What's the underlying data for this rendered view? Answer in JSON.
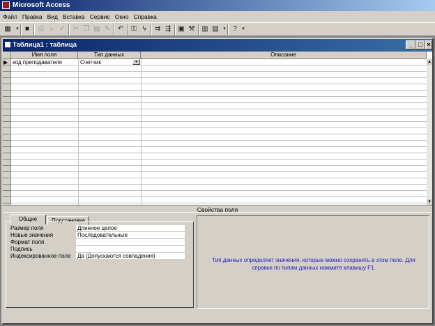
{
  "app": {
    "title": "Microsoft Access"
  },
  "menu": [
    "Файл",
    "Правка",
    "Вид",
    "Вставка",
    "Сервис",
    "Окно",
    "Справка"
  ],
  "window": {
    "title": "Таблица1 : таблица"
  },
  "grid": {
    "columns": [
      "Имя поля",
      "Тип данных",
      "Описание"
    ],
    "rows": [
      {
        "field_name": "код преподавателя",
        "data_type": "Счетчик",
        "description": ""
      }
    ]
  },
  "properties": {
    "section_title": "Свойства поля",
    "tabs": [
      "Общие",
      "Подстановка"
    ],
    "active_tab": "Общие",
    "items": [
      {
        "label": "Размер поля",
        "value": "Длинное целое"
      },
      {
        "label": "Новые значения",
        "value": "Последовательные"
      },
      {
        "label": "Формат поля",
        "value": ""
      },
      {
        "label": "Подпись",
        "value": ""
      },
      {
        "label": "Индексированное поле",
        "value": "Да (Допускаются совпадения)"
      }
    ],
    "help_text": "Тип данных определяет значения, которые можно сохранять в этом поле.  Для справки по типам данных нажмите клавишу F1."
  },
  "colors": {
    "title_bar": "#0a246a",
    "help_text": "#1c1cb8",
    "face": "#d4d0c8"
  }
}
